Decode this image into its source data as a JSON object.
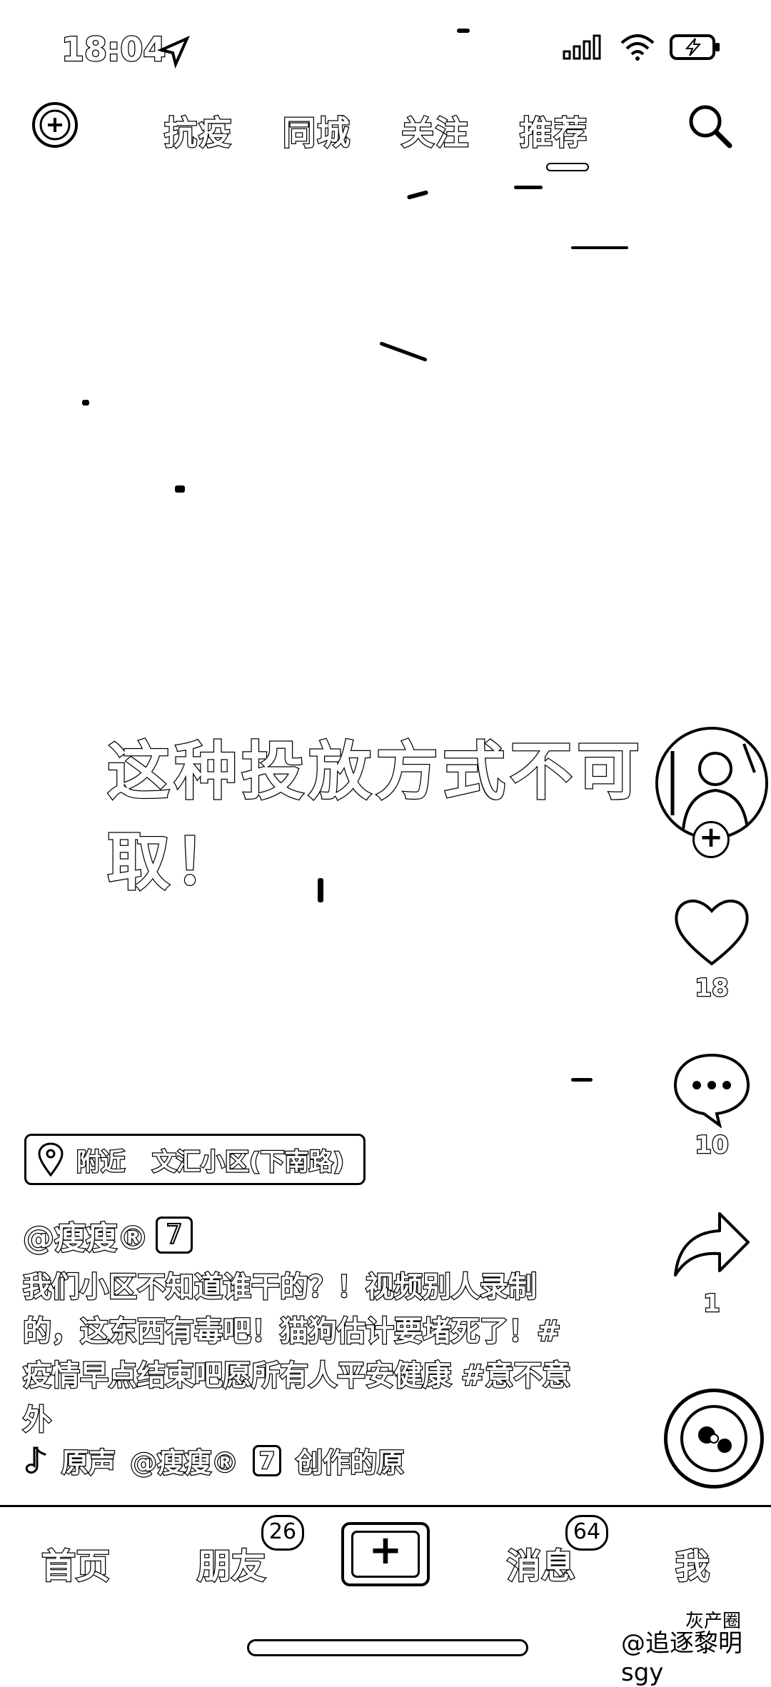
{
  "status_bar": {
    "time": "18:04"
  },
  "top_nav": {
    "tabs": [
      "抗疫",
      "同城",
      "关注",
      "推荐"
    ],
    "active_tab": "推荐"
  },
  "video": {
    "caption": "这种投放方式不可取！"
  },
  "actions": {
    "likes": "18",
    "comments": "10",
    "shares": "1"
  },
  "post": {
    "location_prefix": "附近",
    "location_name": "文汇小区(下南路)",
    "author": "@瘦瘦®",
    "author_badge": "7",
    "description": "我们小区不知道谁干的？！视频别人录制的，这东西有毒吧！猫狗估计要堵死了！#疫情早点结束吧愿所有人平安健康 #意不意外",
    "music_label": "原声",
    "music_author": "@瘦瘦®",
    "music_badge": "7",
    "music_suffix": "创作的原"
  },
  "bottom_nav": {
    "home": "首页",
    "friends": "朋友",
    "friends_badge": "26",
    "messages": "消息",
    "messages_badge": "64",
    "me": "我"
  },
  "watermark": {
    "main": "@追逐黎明sgy",
    "sub": "灰产圈"
  }
}
